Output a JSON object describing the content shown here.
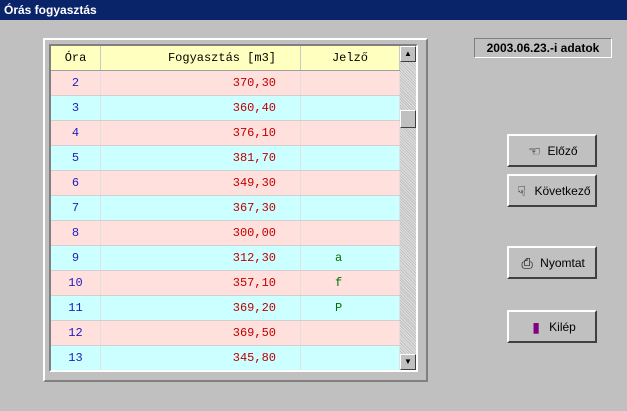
{
  "window": {
    "title": "Órás fogyasztás"
  },
  "date_label": "2003.06.23.-i adatok",
  "table": {
    "columns": [
      "Óra",
      "Fogyasztás [m3]",
      "Jelző"
    ],
    "rows": [
      {
        "ora": "2",
        "fogyasztas": "370,30",
        "jelzo": ""
      },
      {
        "ora": "3",
        "fogyasztas": "360,40",
        "jelzo": ""
      },
      {
        "ora": "4",
        "fogyasztas": "376,10",
        "jelzo": ""
      },
      {
        "ora": "5",
        "fogyasztas": "381,70",
        "jelzo": ""
      },
      {
        "ora": "6",
        "fogyasztas": "349,30",
        "jelzo": ""
      },
      {
        "ora": "7",
        "fogyasztas": "367,30",
        "jelzo": ""
      },
      {
        "ora": "8",
        "fogyasztas": "300,00",
        "jelzo": ""
      },
      {
        "ora": "9",
        "fogyasztas": "312,30",
        "jelzo": "a"
      },
      {
        "ora": "10",
        "fogyasztas": "357,10",
        "jelzo": "f"
      },
      {
        "ora": "11",
        "fogyasztas": "369,20",
        "jelzo": "P"
      },
      {
        "ora": "12",
        "fogyasztas": "369,50",
        "jelzo": ""
      },
      {
        "ora": "13",
        "fogyasztas": "345,80",
        "jelzo": ""
      }
    ]
  },
  "buttons": {
    "prev": {
      "label": "Előző",
      "icon": "hand-pointer-icon"
    },
    "next": {
      "label": "Következő",
      "icon": "hand-pointer-icon"
    },
    "print": {
      "label": "Nyomtat",
      "icon": "printer-icon"
    },
    "exit": {
      "label": "Kilép",
      "icon": "door-exit-icon"
    }
  },
  "colors": {
    "row_even": "#ffe0dc",
    "row_odd": "#ccffff",
    "header": "#ffffc0",
    "titlebar": "#0a246a"
  }
}
